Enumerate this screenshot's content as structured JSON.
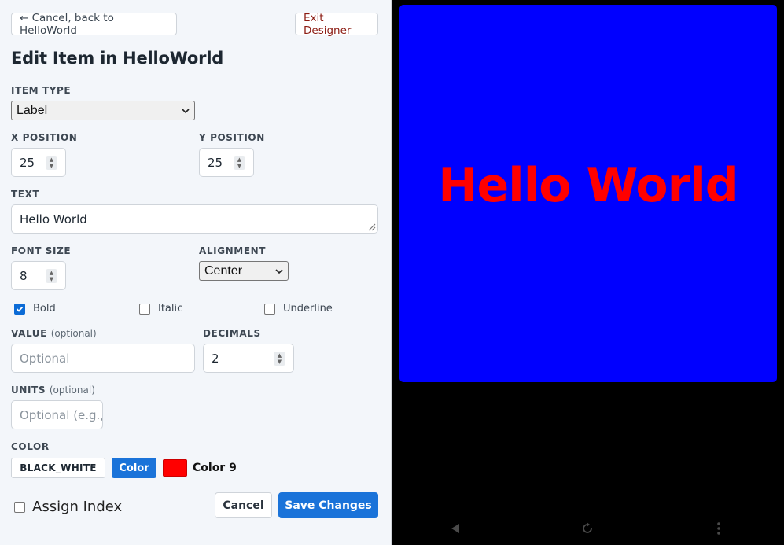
{
  "header": {
    "cancel_back_label": "← Cancel, back to HelloWorld",
    "exit_label": "Exit Designer",
    "title": "Edit Item in HelloWorld"
  },
  "form": {
    "item_type": {
      "label": "ITEM TYPE",
      "value": "Label"
    },
    "x_position": {
      "label": "X POSITION",
      "value": "25"
    },
    "y_position": {
      "label": "Y POSITION",
      "value": "25"
    },
    "text": {
      "label": "TEXT",
      "value": "Hello World"
    },
    "font_size": {
      "label": "FONT SIZE",
      "value": "8"
    },
    "alignment": {
      "label": "ALIGNMENT",
      "value": "Center"
    },
    "bold": {
      "label": "Bold",
      "checked": true
    },
    "italic": {
      "label": "Italic",
      "checked": false
    },
    "underline": {
      "label": "Underline",
      "checked": false
    },
    "value": {
      "label": "VALUE",
      "optional": "(optional)",
      "placeholder": "Optional"
    },
    "decimals": {
      "label": "DECIMALS",
      "value": "2"
    },
    "units": {
      "label": "UNITS",
      "optional": "(optional)",
      "placeholder": "Optional (e.g.,"
    },
    "color": {
      "label": "COLOR",
      "palette_button": "BLACK_WHITE",
      "color_button": "Color",
      "swatch_hex": "#ff0000",
      "color_name": "Color 9"
    },
    "assign_index": {
      "label": "Assign Index",
      "checked": false
    }
  },
  "actions": {
    "cancel_label": "Cancel",
    "save_label": "Save Changes"
  },
  "preview": {
    "background": "#0000ff",
    "text": "Hello World",
    "text_color": "#ff0000"
  },
  "navbar": {
    "back_icon": "back-triangle-icon",
    "refresh_icon": "refresh-icon",
    "more_icon": "more-vertical-icon"
  }
}
